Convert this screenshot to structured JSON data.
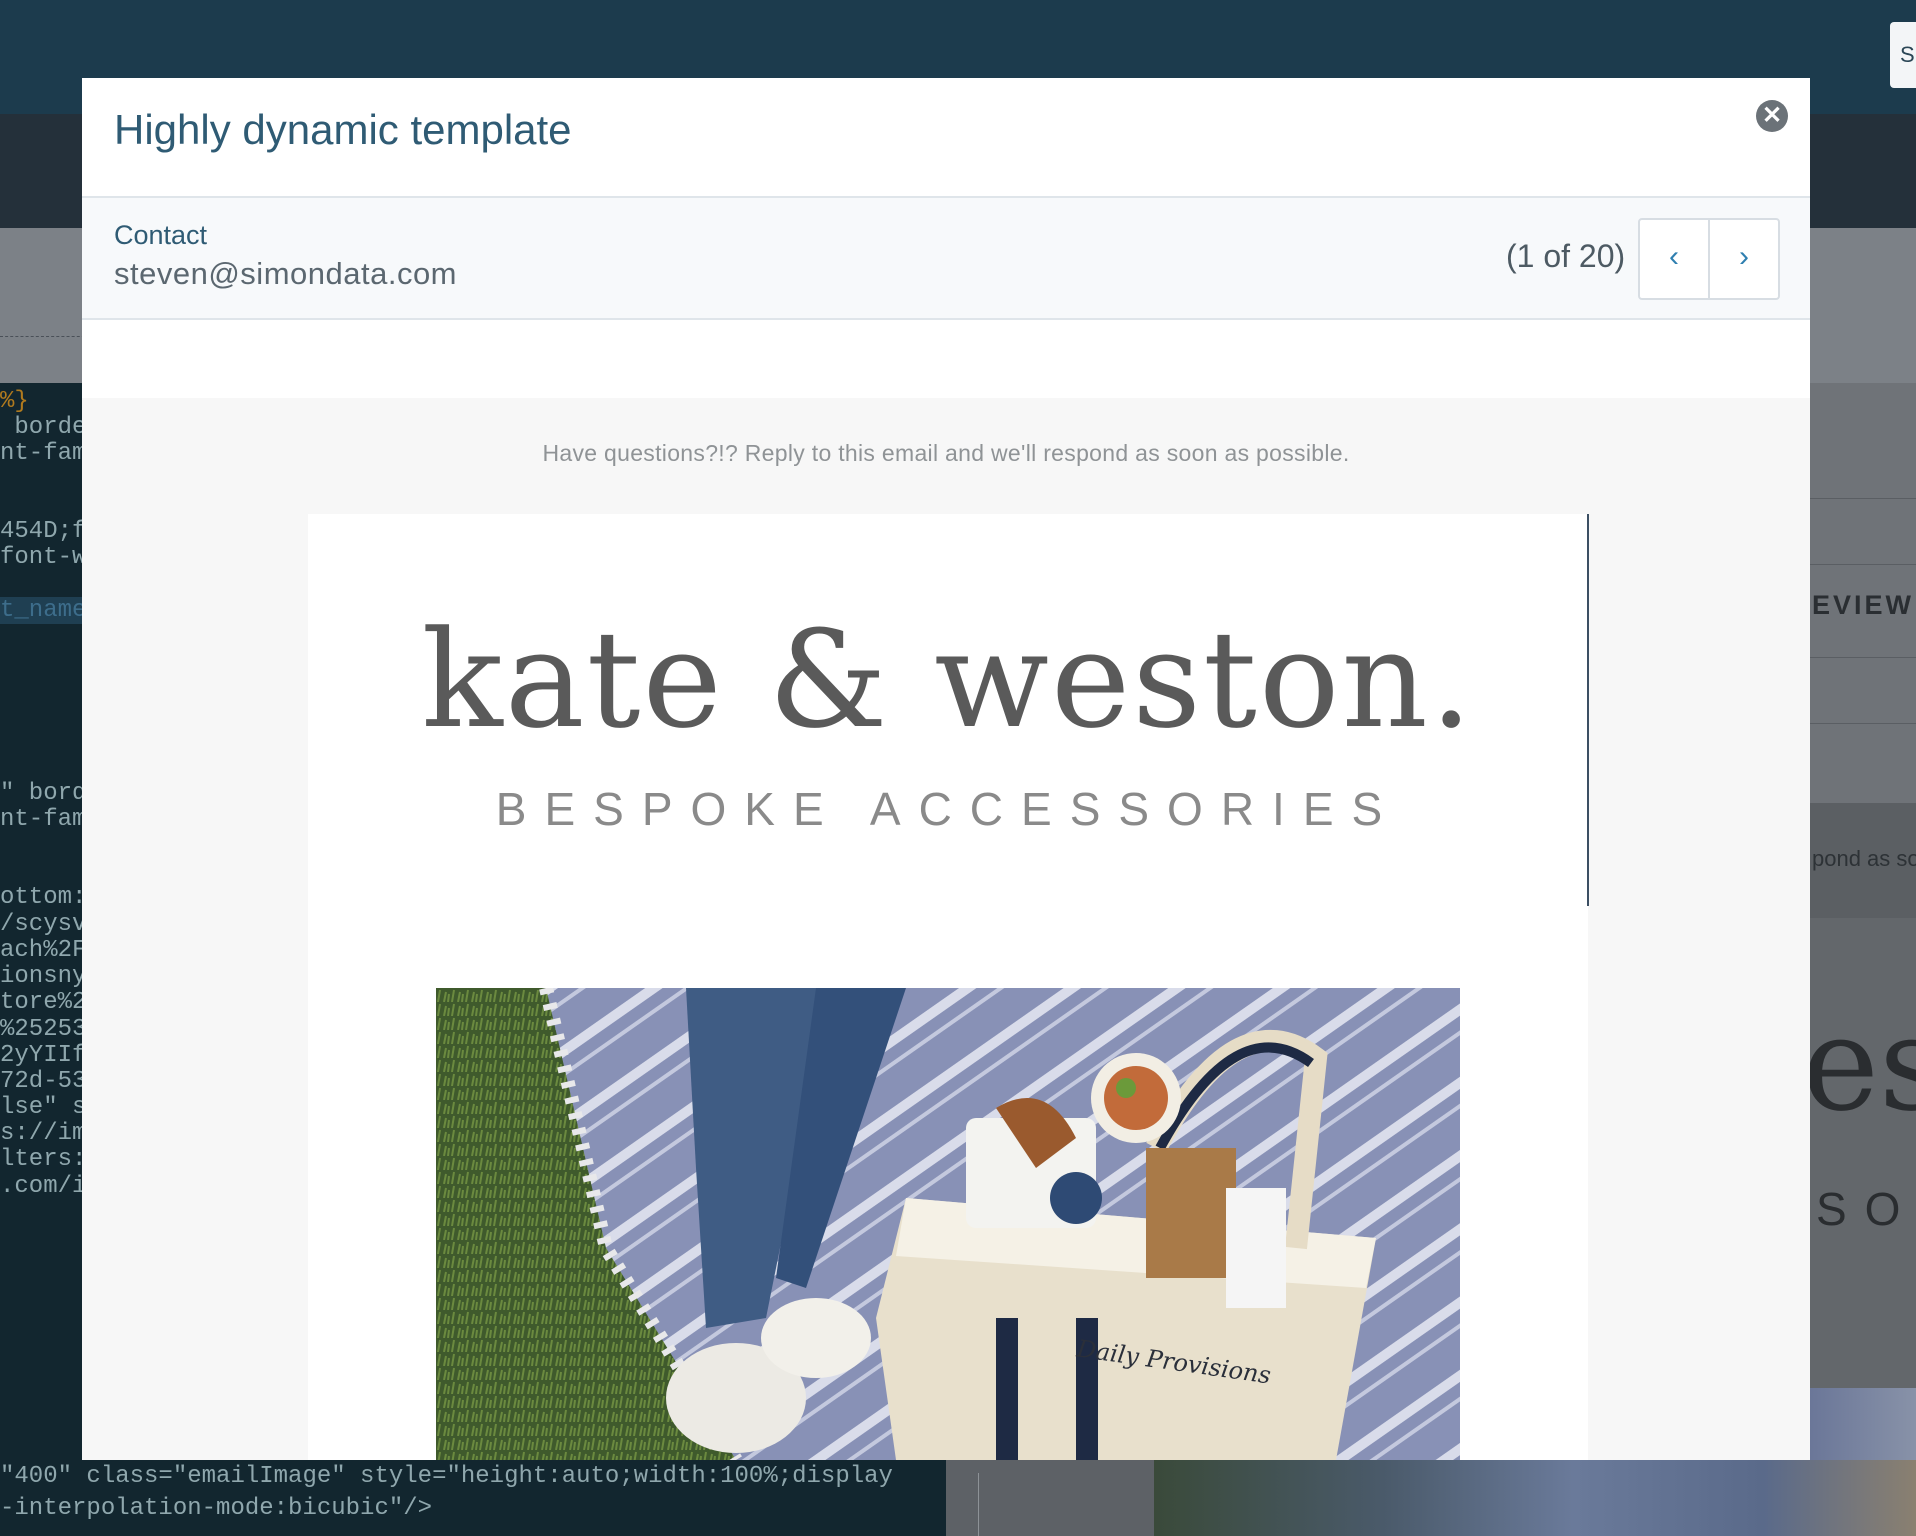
{
  "background": {
    "topbar_button_label": "S",
    "code_lines": [
      {
        "text": "%}",
        "style": "orange"
      },
      {
        "text": " borde",
        "style": ""
      },
      {
        "text": "nt-fam",
        "style": ""
      },
      {
        "text": "454D;f",
        "style": ""
      },
      {
        "text": "font-w",
        "style": ""
      },
      {
        "text": "t_name",
        "style": "hl"
      },
      {
        "text": "\" bord",
        "style": ""
      },
      {
        "text": "nt-fam",
        "style": ""
      },
      {
        "text": "ottom:",
        "style": ""
      },
      {
        "text": "/scysv",
        "style": ""
      },
      {
        "text": "ach%2F",
        "style": ""
      },
      {
        "text": "ionsny",
        "style": ""
      },
      {
        "text": "tore%2",
        "style": ""
      },
      {
        "text": "%25253",
        "style": ""
      },
      {
        "text": "2yYIIf",
        "style": ""
      },
      {
        "text": "72d-53",
        "style": ""
      },
      {
        "text": "lse\" s",
        "style": ""
      },
      {
        "text": "s://im",
        "style": ""
      },
      {
        "text": "lters:",
        "style": ""
      },
      {
        "text": ".com/i",
        "style": ""
      }
    ],
    "code_bottom_line_1": "\"400\" class=\"emailImage\" style=\"height:auto;width:100%;display",
    "code_bottom_line_2": "-interpolation-mode:bicubic\"/>",
    "preview_label": "EVIEW",
    "email_text_fragment": "pond as so",
    "logo_fragment_big": "est",
    "logo_fragment_small": "SOR"
  },
  "modal": {
    "title": "Highly dynamic template",
    "close_icon": "close-circle-icon",
    "contact": {
      "label": "Contact",
      "email": "steven@simondata.com"
    },
    "pager": {
      "count": "(1 of 20)",
      "prev": "‹",
      "next": "›"
    },
    "email": {
      "preheader": "Have questions?!? Reply to this email and we'll respond as soon as possible.",
      "brand_name": "kate & weston.",
      "brand_tagline": "BESPOKE ACCESSORIES",
      "hero_image": "picnic-tote-bag-photo",
      "tote_text": "Daily Provisions"
    }
  },
  "colors": {
    "title": "#2f5b74",
    "accent": "#2f7fb0",
    "header_bg": "#1c3b4d"
  }
}
